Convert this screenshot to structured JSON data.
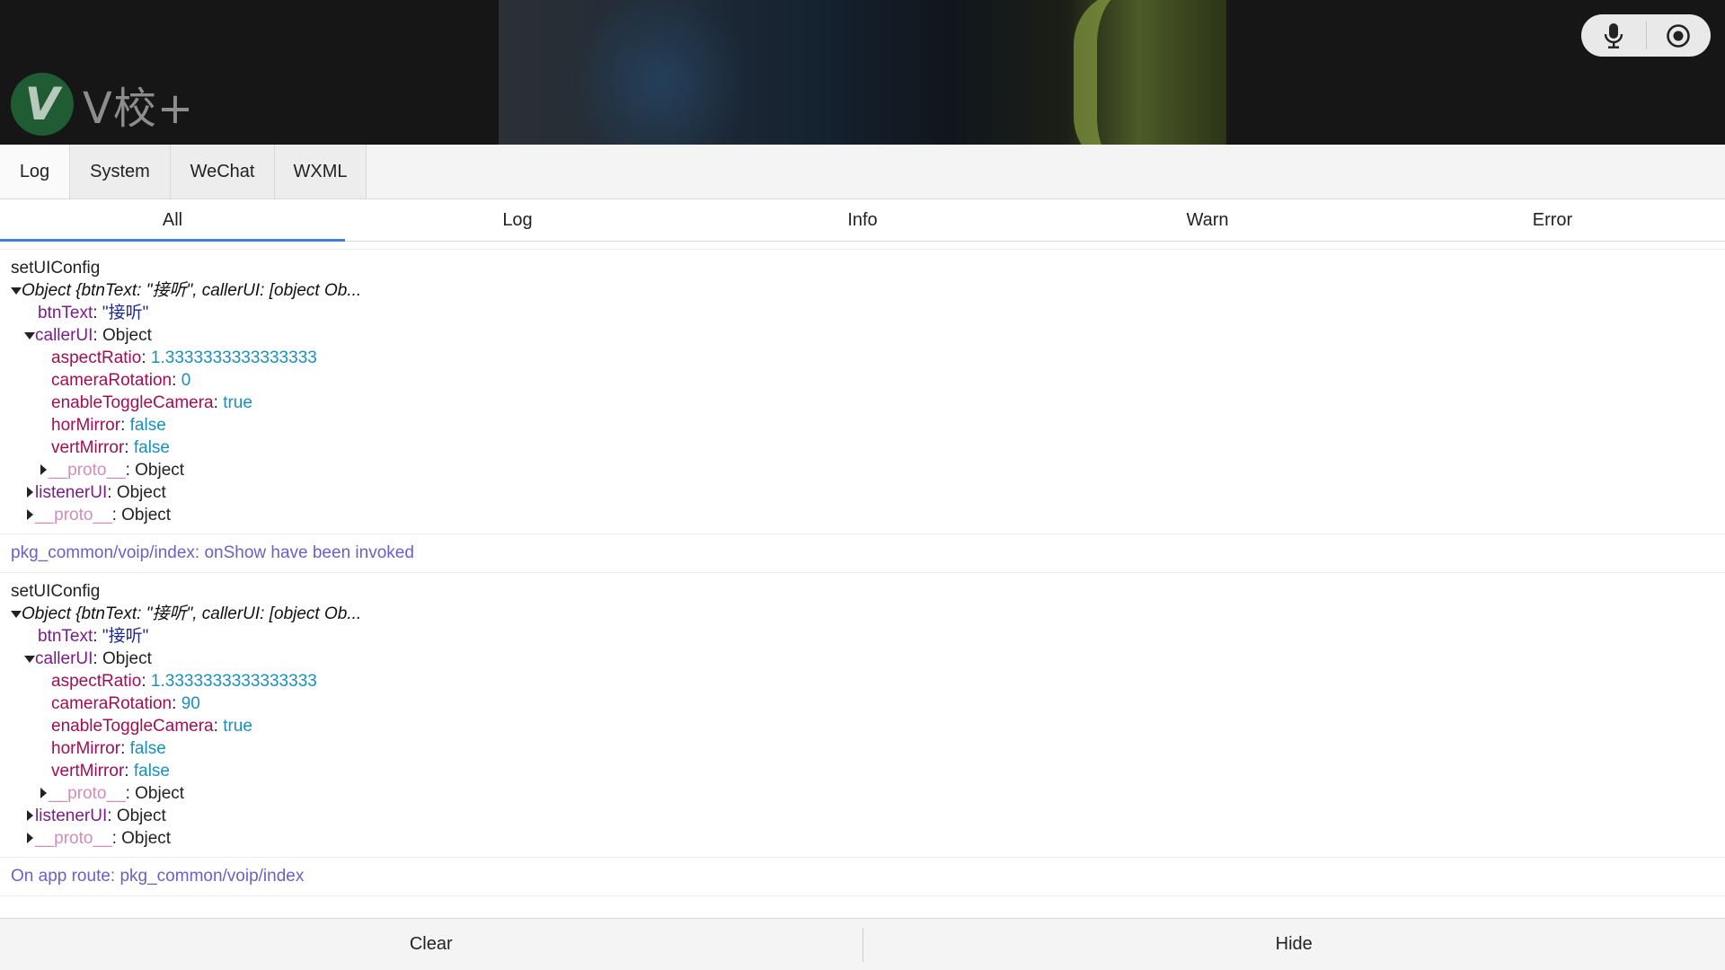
{
  "brand": {
    "logo_letter": "V",
    "name": "V校+"
  },
  "call_controls": {
    "mic_icon": "mic-icon",
    "record_icon": "record-icon"
  },
  "main_tabs": [
    {
      "label": "Log",
      "active": true
    },
    {
      "label": "System",
      "active": false
    },
    {
      "label": "WeChat",
      "active": false
    },
    {
      "label": "WXML",
      "active": false
    }
  ],
  "filter_tabs": [
    {
      "label": "All",
      "active": true
    },
    {
      "label": "Log",
      "active": false
    },
    {
      "label": "Info",
      "active": false
    },
    {
      "label": "Warn",
      "active": false
    },
    {
      "label": "Error",
      "active": false
    }
  ],
  "logs": [
    {
      "title": "setUIConfig",
      "summary": "Object {btnText: \"接听\", callerUI: [object Ob...",
      "btnText_key": "btnText",
      "btnText_value": "\"接听\"",
      "callerUI_key": "callerUI",
      "callerUI_value": "Object",
      "aspectRatio_key": "aspectRatio",
      "aspectRatio_value": "1.3333333333333333",
      "cameraRotation_key": "cameraRotation",
      "cameraRotation_value": "0",
      "enableToggleCamera_key": "enableToggleCamera",
      "enableToggleCamera_value": "true",
      "horMirror_key": "horMirror",
      "horMirror_value": "false",
      "vertMirror_key": "vertMirror",
      "vertMirror_value": "false",
      "inner_proto_key": "__proto__",
      "inner_proto_value": "Object",
      "listenerUI_key": "listenerUI",
      "listenerUI_value": "Object",
      "outer_proto_key": "__proto__",
      "outer_proto_value": "Object"
    },
    {
      "route_text": "pkg_common/voip/index: onShow have been invoked"
    },
    {
      "title": "setUIConfig",
      "summary": "Object {btnText: \"接听\", callerUI: [object Ob...",
      "btnText_key": "btnText",
      "btnText_value": "\"接听\"",
      "callerUI_key": "callerUI",
      "callerUI_value": "Object",
      "aspectRatio_key": "aspectRatio",
      "aspectRatio_value": "1.3333333333333333",
      "cameraRotation_key": "cameraRotation",
      "cameraRotation_value": "90",
      "enableToggleCamera_key": "enableToggleCamera",
      "enableToggleCamera_value": "true",
      "horMirror_key": "horMirror",
      "horMirror_value": "false",
      "vertMirror_key": "vertMirror",
      "vertMirror_value": "false",
      "inner_proto_key": "__proto__",
      "inner_proto_value": "Object",
      "listenerUI_key": "listenerUI",
      "listenerUI_value": "Object",
      "outer_proto_key": "__proto__",
      "outer_proto_value": "Object"
    },
    {
      "route_text": "On app route: pkg_common/voip/index"
    }
  ],
  "bottom": {
    "clear_label": "Clear",
    "hide_label": "Hide"
  },
  "colors": {
    "accent": "#3b7fe0",
    "route_text": "#6c5fc8",
    "key": "#a10e54",
    "number": "#1b8fbc",
    "string": "#1e2a8f",
    "proto": "#d48cb8"
  }
}
